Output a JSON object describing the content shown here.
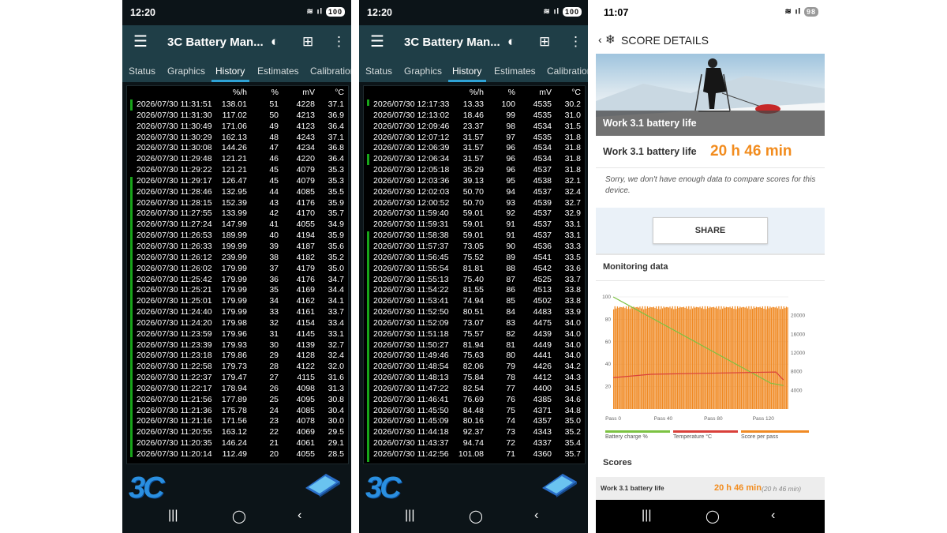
{
  "phone1": {
    "status_time": "12:20",
    "battery": "100",
    "app_title": "3C Battery Man...",
    "tabs": [
      "Status",
      "Graphics",
      "History",
      "Estimates",
      "Calibration"
    ],
    "active_tab": "History",
    "columns": [
      "",
      "%/h",
      "%",
      "mV",
      "°C"
    ],
    "rows": [
      [
        "2026/07/30 11:31:51",
        "138.01",
        "51",
        "4228",
        "37.1"
      ],
      [
        "2026/07/30 11:31:30",
        "117.02",
        "50",
        "4213",
        "36.9"
      ],
      [
        "2026/07/30 11:30:49",
        "171.06",
        "49",
        "4123",
        "36.4"
      ],
      [
        "2026/07/30 11:30:29",
        "162.13",
        "48",
        "4243",
        "37.1"
      ],
      [
        "2026/07/30 11:30:08",
        "144.26",
        "47",
        "4234",
        "36.8"
      ],
      [
        "2026/07/30 11:29:48",
        "121.21",
        "46",
        "4220",
        "36.4"
      ],
      [
        "2026/07/30 11:29:22",
        "121.21",
        "45",
        "4079",
        "35.3"
      ],
      [
        "2026/07/30 11:29:17",
        "126.47",
        "45",
        "4079",
        "35.3"
      ],
      [
        "2026/07/30 11:28:46",
        "132.95",
        "44",
        "4085",
        "35.5"
      ],
      [
        "2026/07/30 11:28:15",
        "152.39",
        "43",
        "4176",
        "35.9"
      ],
      [
        "2026/07/30 11:27:55",
        "133.99",
        "42",
        "4170",
        "35.7"
      ],
      [
        "2026/07/30 11:27:24",
        "147.99",
        "41",
        "4055",
        "34.9"
      ],
      [
        "2026/07/30 11:26:53",
        "189.99",
        "40",
        "4194",
        "35.9"
      ],
      [
        "2026/07/30 11:26:33",
        "199.99",
        "39",
        "4187",
        "35.6"
      ],
      [
        "2026/07/30 11:26:12",
        "239.99",
        "38",
        "4182",
        "35.2"
      ],
      [
        "2026/07/30 11:26:02",
        "179.99",
        "37",
        "4179",
        "35.0"
      ],
      [
        "2026/07/30 11:25:42",
        "179.99",
        "36",
        "4176",
        "34.7"
      ],
      [
        "2026/07/30 11:25:21",
        "179.99",
        "35",
        "4169",
        "34.4"
      ],
      [
        "2026/07/30 11:25:01",
        "179.99",
        "34",
        "4162",
        "34.1"
      ],
      [
        "2026/07/30 11:24:40",
        "179.99",
        "33",
        "4161",
        "33.7"
      ],
      [
        "2026/07/30 11:24:20",
        "179.98",
        "32",
        "4154",
        "33.4"
      ],
      [
        "2026/07/30 11:23:59",
        "179.96",
        "31",
        "4145",
        "33.1"
      ],
      [
        "2026/07/30 11:23:39",
        "179.93",
        "30",
        "4139",
        "32.7"
      ],
      [
        "2026/07/30 11:23:18",
        "179.86",
        "29",
        "4128",
        "32.4"
      ],
      [
        "2026/07/30 11:22:58",
        "179.73",
        "28",
        "4122",
        "32.0"
      ],
      [
        "2026/07/30 11:22:37",
        "179.47",
        "27",
        "4115",
        "31.6"
      ],
      [
        "2026/07/30 11:22:17",
        "178.94",
        "26",
        "4098",
        "31.3"
      ],
      [
        "2026/07/30 11:21:56",
        "177.89",
        "25",
        "4095",
        "30.8"
      ],
      [
        "2026/07/30 11:21:36",
        "175.78",
        "24",
        "4085",
        "30.4"
      ],
      [
        "2026/07/30 11:21:16",
        "171.56",
        "23",
        "4078",
        "30.0"
      ],
      [
        "2026/07/30 11:20:55",
        "163.12",
        "22",
        "4069",
        "29.5"
      ],
      [
        "2026/07/30 11:20:35",
        "146.24",
        "21",
        "4061",
        "29.1"
      ],
      [
        "2026/07/30 11:20:14",
        "112.49",
        "20",
        "4055",
        "28.5"
      ]
    ],
    "logo": "3C"
  },
  "phone2": {
    "status_time": "12:20",
    "battery": "100",
    "app_title": "3C Battery Man...",
    "tabs": [
      "Status",
      "Graphics",
      "History",
      "Estimates",
      "Calibration"
    ],
    "active_tab": "History",
    "columns": [
      "",
      "%/h",
      "%",
      "mV",
      "°C"
    ],
    "rows": [
      [
        "2026/07/30 12:17:33",
        "13.33",
        "100",
        "4535",
        "30.2"
      ],
      [
        "2026/07/30 12:13:02",
        "18.46",
        "99",
        "4535",
        "31.0"
      ],
      [
        "2026/07/30 12:09:46",
        "23.37",
        "98",
        "4534",
        "31.5"
      ],
      [
        "2026/07/30 12:07:12",
        "31.57",
        "97",
        "4535",
        "31.8"
      ],
      [
        "2026/07/30 12:06:39",
        "31.57",
        "96",
        "4534",
        "31.8"
      ],
      [
        "2026/07/30 12:06:34",
        "31.57",
        "96",
        "4534",
        "31.8"
      ],
      [
        "2026/07/30 12:05:18",
        "35.29",
        "96",
        "4537",
        "31.8"
      ],
      [
        "2026/07/30 12:03:36",
        "39.13",
        "95",
        "4538",
        "32.1"
      ],
      [
        "2026/07/30 12:02:03",
        "50.70",
        "94",
        "4537",
        "32.4"
      ],
      [
        "2026/07/30 12:00:52",
        "50.70",
        "93",
        "4539",
        "32.7"
      ],
      [
        "2026/07/30 11:59:40",
        "59.01",
        "92",
        "4537",
        "32.9"
      ],
      [
        "2026/07/30 11:59:31",
        "59.01",
        "91",
        "4537",
        "33.1"
      ],
      [
        "2026/07/30 11:58:38",
        "59.01",
        "91",
        "4537",
        "33.1"
      ],
      [
        "2026/07/30 11:57:37",
        "73.05",
        "90",
        "4536",
        "33.3"
      ],
      [
        "2026/07/30 11:56:45",
        "75.52",
        "89",
        "4541",
        "33.5"
      ],
      [
        "2026/07/30 11:55:54",
        "81.81",
        "88",
        "4542",
        "33.6"
      ],
      [
        "2026/07/30 11:55:13",
        "75.40",
        "87",
        "4525",
        "33.7"
      ],
      [
        "2026/07/30 11:54:22",
        "81.55",
        "86",
        "4513",
        "33.8"
      ],
      [
        "2026/07/30 11:53:41",
        "74.94",
        "85",
        "4502",
        "33.8"
      ],
      [
        "2026/07/30 11:52:50",
        "80.51",
        "84",
        "4483",
        "33.9"
      ],
      [
        "2026/07/30 11:52:09",
        "73.07",
        "83",
        "4475",
        "34.0"
      ],
      [
        "2026/07/30 11:51:18",
        "75.57",
        "82",
        "4439",
        "34.0"
      ],
      [
        "2026/07/30 11:50:27",
        "81.94",
        "81",
        "4449",
        "34.0"
      ],
      [
        "2026/07/30 11:49:46",
        "75.63",
        "80",
        "4441",
        "34.0"
      ],
      [
        "2026/07/30 11:48:54",
        "82.06",
        "79",
        "4426",
        "34.2"
      ],
      [
        "2026/07/30 11:48:13",
        "75.84",
        "78",
        "4412",
        "34.3"
      ],
      [
        "2026/07/30 11:47:22",
        "82.54",
        "77",
        "4400",
        "34.5"
      ],
      [
        "2026/07/30 11:46:41",
        "76.69",
        "76",
        "4385",
        "34.6"
      ],
      [
        "2026/07/30 11:45:50",
        "84.48",
        "75",
        "4371",
        "34.8"
      ],
      [
        "2026/07/30 11:45:09",
        "80.16",
        "74",
        "4357",
        "35.0"
      ],
      [
        "2026/07/30 11:44:18",
        "92.37",
        "73",
        "4343",
        "35.2"
      ],
      [
        "2026/07/30 11:43:37",
        "94.74",
        "72",
        "4337",
        "35.4"
      ],
      [
        "2026/07/30 11:42:56",
        "101.08",
        "71",
        "4360",
        "35.7"
      ]
    ],
    "logo": "3C"
  },
  "phone3": {
    "status_time": "11:07",
    "battery": "98",
    "header_title": "SCORE DETAILS",
    "hero_caption": "Work 3.1 battery life",
    "score_label": "Work 3.1 battery life",
    "score_value": "20 h 46 min",
    "sorry_text": "Sorry, we don't have enough data to compare scores for this device.",
    "share_label": "SHARE",
    "monitoring_title": "Monitoring data",
    "legend": [
      {
        "label": "Battery charge %",
        "color": "#7cc242"
      },
      {
        "label": "Temperature °C",
        "color": "#d9403a"
      },
      {
        "label": "Score per pass",
        "color": "#f08a24"
      }
    ],
    "scores_title": "Scores",
    "score_row_label": "Work 3.1 battery life",
    "score_row_value": "20 h 46 min",
    "score_row_sub": "(20 h 46 min)"
  },
  "chart_data": {
    "type": "bar",
    "x_ticks": [
      "Pass 0",
      "Pass 40",
      "Pass 80",
      "Pass 120"
    ],
    "y_left_ticks": [
      "100",
      "80",
      "60",
      "40",
      "20"
    ],
    "y_right_ticks": [
      "20000",
      "16000",
      "12000",
      "8000",
      "4000"
    ],
    "ylim_left": [
      0,
      100
    ],
    "ylim_right": [
      0,
      24000
    ],
    "passes": 140,
    "series": [
      {
        "name": "Score per pass",
        "axis": "right",
        "typical_value": 22000,
        "color": "#f08a24"
      },
      {
        "name": "Battery charge %",
        "axis": "left",
        "x": [
          0,
          126,
          136
        ],
        "values": [
          100,
          23,
          21
        ],
        "color": "#7cc242"
      },
      {
        "name": "Temperature °C",
        "axis": "left",
        "x": [
          0,
          30,
          80,
          130,
          136
        ],
        "values": [
          28,
          31,
          32,
          33,
          26
        ],
        "color": "#d9403a"
      }
    ]
  }
}
